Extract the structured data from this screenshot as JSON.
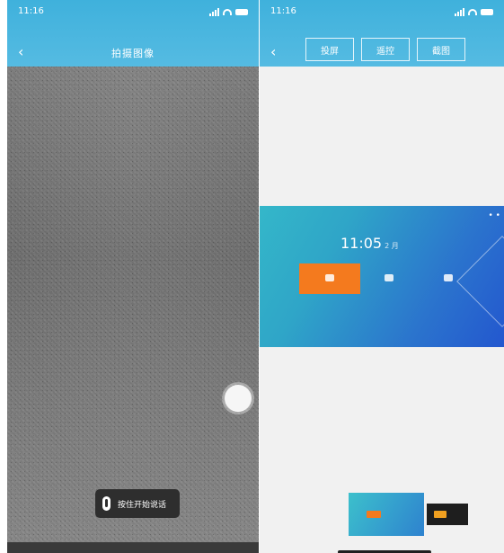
{
  "left_screen": {
    "status_time": "11:16",
    "title": "拍摄图像",
    "back_glyph": "‹",
    "voice_button_label": "按住开始说话",
    "icons": [
      "back-icon",
      "signal-icon",
      "wifi-icon",
      "battery-icon",
      "shutter-button",
      "microphone-icon"
    ]
  },
  "right_screen": {
    "status_time": "11:16",
    "back_glyph": "‹",
    "tabs": [
      "投屏",
      "遥控",
      "截图"
    ],
    "banner": {
      "time": "11:05",
      "time_suffix": "2 月",
      "dots": "• •",
      "buttons": [
        "",
        "",
        ""
      ]
    }
  },
  "colors": {
    "header_blue": "#3fb1dc",
    "accent_orange": "#f47a1e",
    "banner_from": "#34b7c9",
    "banner_to": "#2357cf"
  }
}
